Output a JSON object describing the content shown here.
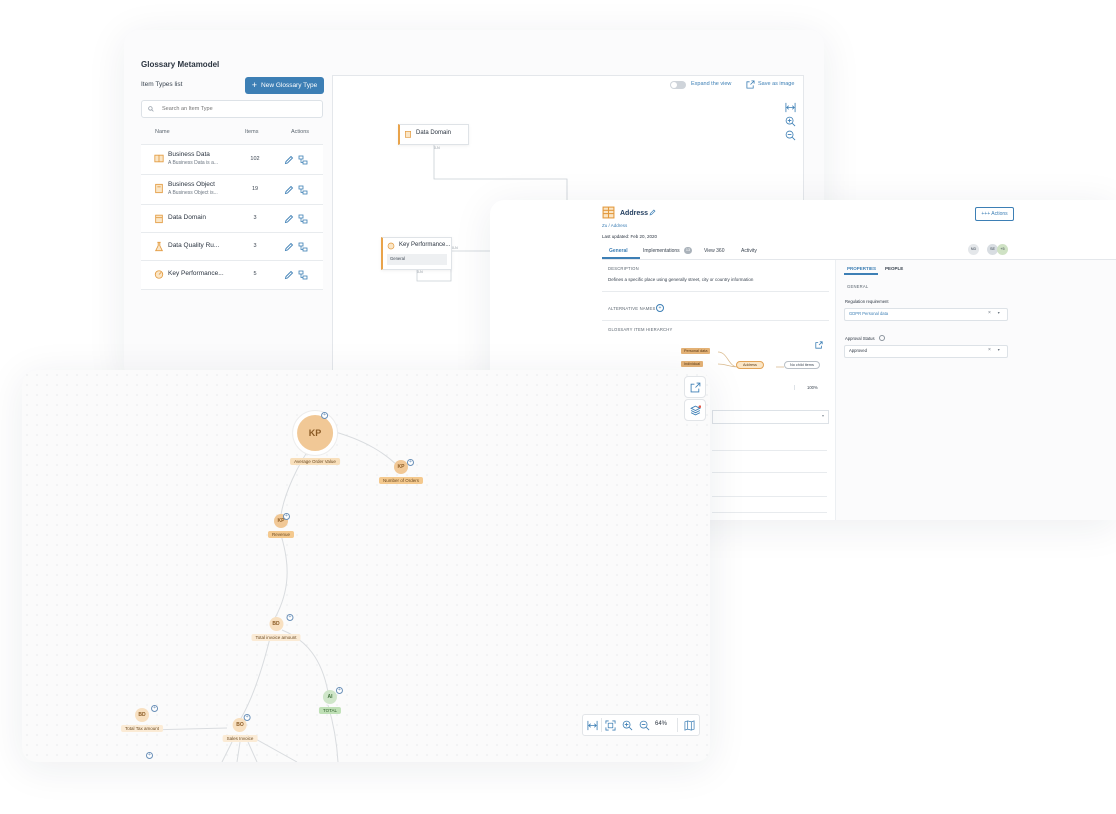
{
  "colors": {
    "accent": "#3d7fb5",
    "node_orange": "#e9a34a",
    "node_green": "#8dc58a"
  },
  "glossary": {
    "title": "Glossary Metamodel",
    "list_label": "Item Types list",
    "new_button": "New Glossary Type",
    "search_placeholder": "Search an Item Type",
    "columns": {
      "name": "Name",
      "items": "Items",
      "actions": "Actions"
    },
    "rows": [
      {
        "name": "Business Data",
        "desc": "A Business Data is a...",
        "count": "102",
        "icon": "book-icon"
      },
      {
        "name": "Business Object",
        "desc": "A Business Object is...",
        "count": "19",
        "icon": "document-icon"
      },
      {
        "name": "Data Domain",
        "desc": "",
        "count": "3",
        "icon": "building-icon"
      },
      {
        "name": "Data Quality Ru...",
        "desc": "",
        "count": "3",
        "icon": "flask-icon"
      },
      {
        "name": "Key Performance...",
        "desc": "",
        "count": "5",
        "icon": "gauge-icon"
      }
    ],
    "canvas": {
      "expand_label": "Expand the view",
      "save_image_label": "Save as image",
      "nodes": [
        {
          "label": "Data Domain",
          "card": "0-N"
        },
        {
          "label": "Key Performance...",
          "section": "General",
          "card_right": "0-N",
          "card_bottom": "0-N"
        }
      ]
    }
  },
  "address": {
    "title": "Address",
    "breadcrumb": "Zu / Address",
    "last_updated": "Last updated: Feb 20, 2020",
    "actions_label": "+++ Actions",
    "tabs": [
      "General",
      "Implementations",
      "View 360",
      "Activity"
    ],
    "implementations_count": "13",
    "avatars": [
      "ND",
      "SE",
      "+5"
    ],
    "description_label": "DESCRIPTION",
    "description": "Defines a specific place using generally street, city or country information",
    "alt_names_label": "ALTERNATIVE NAMES",
    "hierarchy_label": "GLOSSARY ITEM HIERARCHY",
    "hierarchy_nodes": [
      "Personal data",
      "Individual",
      "Address",
      "No child items"
    ],
    "zoom": "100%",
    "props_tabs": [
      "PROPERTIES",
      "PEOPLE"
    ],
    "general_label": "GENERAL",
    "regulation_label": "Regulation requirement",
    "regulation_value": "GDPR Personal data",
    "approval_label": "Approval Status",
    "approval_value": "Approved"
  },
  "graph": {
    "nodes": [
      {
        "abbr": "KP",
        "label": "Average Order Value",
        "kind": "orange"
      },
      {
        "abbr": "KP",
        "label": "Number of Orders",
        "kind": "orange"
      },
      {
        "abbr": "KP",
        "label": "Revenue",
        "kind": "orange"
      },
      {
        "abbr": "BD",
        "label": "Total invoice amount",
        "kind": "light"
      },
      {
        "abbr": "AI",
        "label": "TOTAL",
        "kind": "green"
      },
      {
        "abbr": "BD",
        "label": "Total Tax amount",
        "kind": "light"
      },
      {
        "abbr": "BO",
        "label": "Sales Invoice",
        "kind": "light"
      }
    ],
    "zoom": "64%"
  }
}
